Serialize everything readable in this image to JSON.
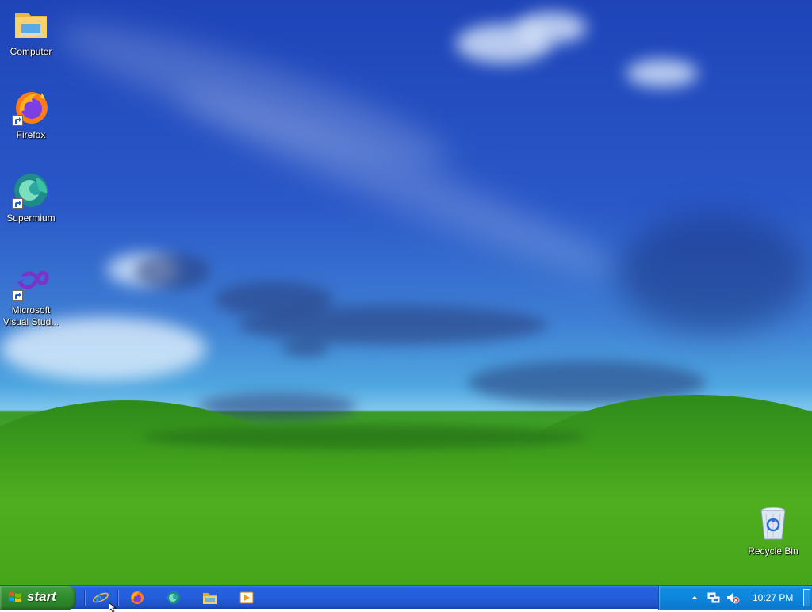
{
  "desktop": {
    "icons": [
      {
        "label": "Computer",
        "icon": "computer-folder-icon",
        "shortcut": false
      },
      {
        "label": "Firefox",
        "icon": "firefox-icon",
        "shortcut": true
      },
      {
        "label": "Supermium",
        "icon": "supermium-icon",
        "shortcut": true
      },
      {
        "label": "Microsoft Visual Stud...",
        "icon": "visual-studio-icon",
        "shortcut": true
      },
      {
        "label": "Recycle Bin",
        "icon": "recycle-bin-icon",
        "shortcut": false
      }
    ]
  },
  "taskbar": {
    "start_label": "start",
    "quick_launch": [
      {
        "name": "internet-explorer-icon"
      },
      {
        "name": "firefox-icon"
      },
      {
        "name": "supermium-icon"
      },
      {
        "name": "file-explorer-icon"
      },
      {
        "name": "media-player-icon"
      }
    ],
    "tray": {
      "clock": "10:27 PM",
      "icons": [
        "show-hidden-icons-chevron",
        "network-icon",
        "volume-muted-icon"
      ]
    }
  },
  "colors": {
    "taskbar_blue": "#245edb",
    "start_green": "#2f8b2d",
    "tray_blue": "#0d86dc",
    "sky_top": "#1e44b8",
    "grass": "#47a81a"
  }
}
